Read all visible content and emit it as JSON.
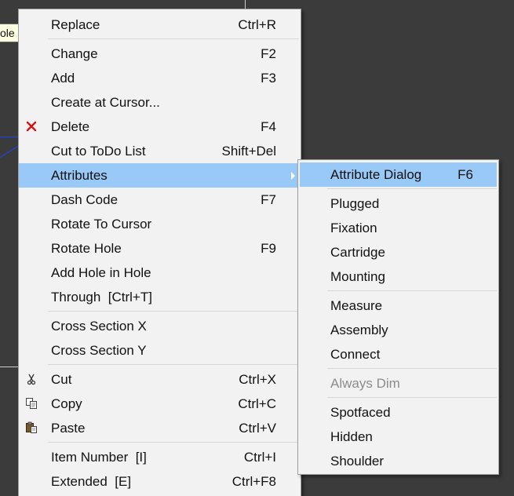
{
  "tooltip": {
    "text": "ole"
  },
  "main_menu": {
    "items": [
      {
        "label": "Replace",
        "shortcut": "Ctrl+R"
      },
      {
        "label": "Change",
        "shortcut": "F2"
      },
      {
        "label": "Add",
        "shortcut": "F3"
      },
      {
        "label": "Create at Cursor...",
        "shortcut": ""
      },
      {
        "label": "Delete",
        "shortcut": "F4",
        "icon": "delete-x-icon"
      },
      {
        "label": "Cut to ToDo List",
        "shortcut": "Shift+Del"
      },
      {
        "label": "Attributes",
        "shortcut": "",
        "submenu": true
      },
      {
        "label": "Dash Code",
        "shortcut": "F7"
      },
      {
        "label": "Rotate To Cursor",
        "shortcut": ""
      },
      {
        "label": "Rotate Hole",
        "shortcut": "F9"
      },
      {
        "label": "Add Hole in Hole",
        "shortcut": ""
      },
      {
        "label": "Through  [Ctrl+T]",
        "shortcut": ""
      },
      {
        "label": "Cross Section X",
        "shortcut": ""
      },
      {
        "label": "Cross Section Y",
        "shortcut": ""
      },
      {
        "label": "Cut",
        "shortcut": "Ctrl+X",
        "icon": "scissors-icon"
      },
      {
        "label": "Copy",
        "shortcut": "Ctrl+C",
        "icon": "copy-icon"
      },
      {
        "label": "Paste",
        "shortcut": "Ctrl+V",
        "icon": "paste-icon"
      },
      {
        "label": "Item Number  [I]",
        "shortcut": "Ctrl+I"
      },
      {
        "label": "Extended  [E]",
        "shortcut": "Ctrl+F8"
      }
    ]
  },
  "sub_menu": {
    "items": [
      {
        "label": "Attribute Dialog",
        "shortcut": "F6"
      },
      {
        "label": "Plugged"
      },
      {
        "label": "Fixation"
      },
      {
        "label": "Cartridge"
      },
      {
        "label": "Mounting"
      },
      {
        "label": "Measure"
      },
      {
        "label": "Assembly"
      },
      {
        "label": "Connect"
      },
      {
        "label": "Always Dim",
        "disabled": true
      },
      {
        "label": "Spotfaced"
      },
      {
        "label": "Hidden"
      },
      {
        "label": "Shoulder"
      }
    ]
  },
  "colors": {
    "highlight": "#99c9f7",
    "menu_bg": "#f2f2f2",
    "delete_icon": "#d21414",
    "disabled_text": "#8c8c8c"
  }
}
